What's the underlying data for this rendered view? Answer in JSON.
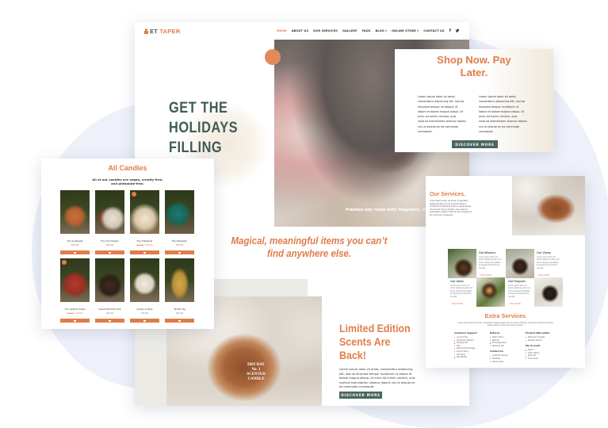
{
  "colors": {
    "accent": "#e07c4a",
    "dark_green": "#3e5b56",
    "button": "#4a6661",
    "blob": "#eef1f9"
  },
  "main_page": {
    "logo": {
      "icon": "candle-flame-icon",
      "prefix": "ET",
      "name": "TAPER"
    },
    "nav": {
      "items": [
        {
          "label": "HOME",
          "active": true
        },
        {
          "label": "ABOUT US"
        },
        {
          "label": "OUR SERVICES"
        },
        {
          "label": "GALLERY"
        },
        {
          "label": "FAQS"
        },
        {
          "label": "BLOG ▾"
        },
        {
          "label": "ONLINE STORE ▾"
        },
        {
          "label": "CONTACT US"
        }
      ],
      "social": [
        {
          "icon": "facebook-icon",
          "glyph": "f"
        },
        {
          "icon": "twitter-icon",
          "glyph": "🐦"
        }
      ]
    },
    "hero_title": "GET THE\nHOLIDAYS\nFILLING",
    "hero_caption": "Freshen any room with fragrance, style, and",
    "tagline": "Magical, meaningful items you can’t find anywhere else.",
    "jar_label": "DRY BAY\nNo. 1\nSCENTED CANDLE",
    "limited": {
      "title": "Limited Edition\nScents Are\nBack!",
      "body": "Lorem ipsum dolor sit amet, consectetur adipiscing elit, sed do eiusmod tempor incididunt ut labore et dolore magna aliqua. Ut enim ad minim veniam, quis nostrud exercitation ullamco laboris nisi ut aliquip ex ea commodo consequat.",
      "button": "DISCOVER MORE"
    }
  },
  "shop_card": {
    "title": "Shop Now. Pay\nLater.",
    "col1": "Lorem ipsum dolor sit amet, consectetur adipiscing elit, sed do eiusmod tempor incididunt ut labore et dolore magna aliqua. Ut enim ad minim veniam, quis nostrud exercitation ullamco laboris nisi ut aliquip ex ea commodo consequat.",
    "col2": "Lorem ipsum dolor sit amet, consectetur adipiscing elit, sed do eiusmod tempor incididunt ut labore et dolore magna aliqua. Ut enim ad minim veniam, quis nostrud exercitation ullamco laboris nisi ut aliquip ex ea commodo consequat.",
    "button": "DISCOVER MORE"
  },
  "candles_card": {
    "title": "All Candles",
    "subtitle": "All of our candles are vegan, cruelty-free, and phthalate-free.",
    "products": [
      {
        "name": "The Southgate",
        "price": "$35.00"
      },
      {
        "name": "The City Dweller",
        "price": "$35.00"
      },
      {
        "name": "The Trailblazer",
        "old_price": "$40.00",
        "price": "$30.00",
        "sale": true
      },
      {
        "name": "The Stargazer",
        "price": "$35.00"
      },
      {
        "name": "The Yuletide Treats",
        "old_price": "$40.00",
        "price": "$30.00",
        "sale": true
      },
      {
        "name": "Sweet Rambler Mint",
        "price": "$35.00"
      },
      {
        "name": "Amber & Moss",
        "price": "$35.00"
      },
      {
        "name": "Winter Fig",
        "price": "$35.00"
      }
    ],
    "cart_icon": "cart-icon"
  },
  "services_card": {
    "title": "Our Services.",
    "body": "Lorem ipsum dolor sit amet, consectetur adipiscing elit, sed do eiusmod tempor incididunt ut labore et dolore magna aliqua. Ut enim ad minim veniam, quis nostrud exercitation ullamco laboris nisi ut aliquip ex ea commodo consequat.",
    "tiles": [
      {
        "title": "Our Mission",
        "body": "Lorem ipsum dolor sit amet, adipiscing elit. Cum sociis natoque penatibus et magnis dis parturient montes.",
        "link": "→ READ MORE"
      },
      {
        "title": "Our Vision",
        "body": "Lorem ipsum dolor sit amet, adipiscing elit. Cum sociis natoque penatibus et magnis dis parturient montes.",
        "link": "→ READ MORE"
      },
      {
        "title": "Our Value",
        "body": "Lorem ipsum dolor sit amet, adipiscing elit. Cum sociis natoque penatibus et magnis dis parturient montes.",
        "link": "→ READ MORE"
      },
      {
        "title": "Our Purpose",
        "body": "Lorem ipsum dolor sit amet, adipiscing elit. Cum sociis natoque penatibus et magnis dis parturient montes.",
        "link": "→ READ MORE"
      }
    ],
    "extra": {
      "title": "Extra Services",
      "subtitle": "Lorem ipsum dolor sit amet, consectetur adipiscing elit, sed do eiusmod tempor incididunt ut labore et dolore magna aliqua. Ut enim ad minim veniam.",
      "columns": [
        {
          "heading": "Customer Support",
          "items": [
            "Account Tips",
            "Ordering & Delivery",
            "Shipping Info",
            "FAQ",
            "Returns & Exchanges",
            "Privacy Policy",
            "Gift Cards",
            "Get Started"
          ]
        },
        {
          "heading": "Returns",
          "items": [
            "Return Policy",
            "Refunds",
            "Exchange Policy",
            "Warranty Info"
          ],
          "heading2": "Contact Us",
          "items2": [
            "Customer Service",
            "Feedback",
            "Store Locator"
          ]
        },
        {
          "heading": "Product Warranties",
          "items": [
            "Warranty Coverage",
            "Register Product"
          ],
          "heading2": "My Account",
          "items2": [
            "Sign In",
            "Order History",
            "Wish List",
            "Track Order"
          ]
        }
      ]
    }
  }
}
